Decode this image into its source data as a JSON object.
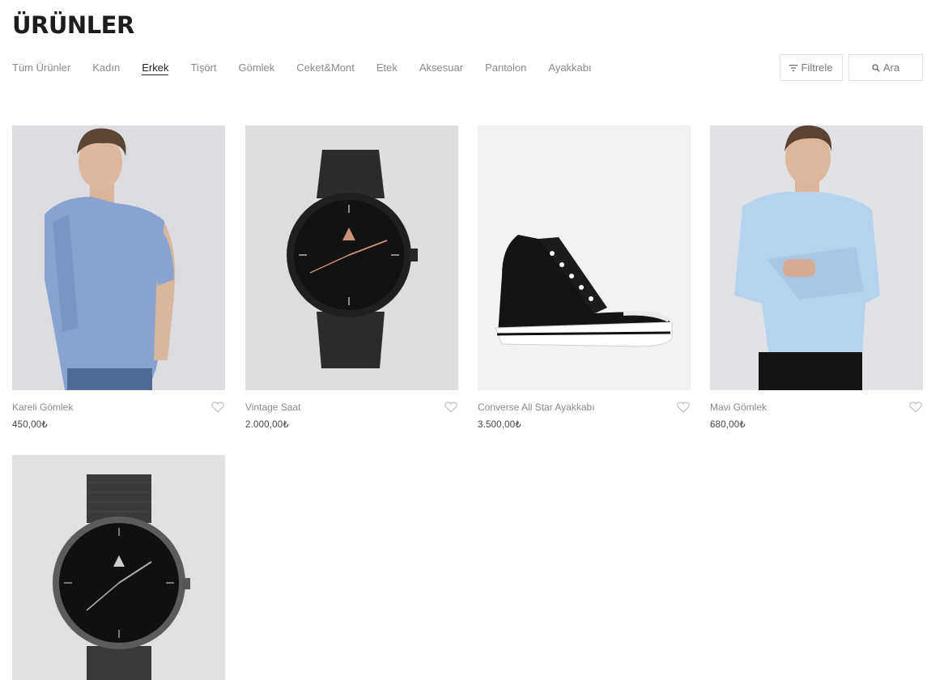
{
  "page": {
    "title": "ÜRÜNLER"
  },
  "categories": [
    {
      "label": "Tüm Ürünler",
      "active": false
    },
    {
      "label": "Kadın",
      "active": false
    },
    {
      "label": "Erkek",
      "active": true
    },
    {
      "label": "Tişört",
      "active": false
    },
    {
      "label": "Gömlek",
      "active": false
    },
    {
      "label": "Ceket&Mont",
      "active": false
    },
    {
      "label": "Etek",
      "active": false
    },
    {
      "label": "Aksesuar",
      "active": false
    },
    {
      "label": "Pantolon",
      "active": false
    },
    {
      "label": "Ayakkabı",
      "active": false
    }
  ],
  "toolbar": {
    "filter_label": "Filtrele",
    "search_label": "Ara"
  },
  "products": [
    {
      "name": "Kareli Gömlek",
      "price": "450,00₺",
      "image": "man-checked-shirt"
    },
    {
      "name": "Vintage Saat",
      "price": "2.000,00₺",
      "image": "black-watch"
    },
    {
      "name": "Converse All Star Ayakkabı",
      "price": "3.500,00₺",
      "image": "black-sneaker"
    },
    {
      "name": "Mavi Gömlek",
      "price": "680,00₺",
      "image": "man-blue-shirt"
    },
    {
      "name": "",
      "price": "",
      "image": "mesh-watch"
    }
  ],
  "colors": {
    "text_muted": "#8a8a8a",
    "text_dark": "#1d1d1d",
    "border": "#e1e1e1"
  }
}
